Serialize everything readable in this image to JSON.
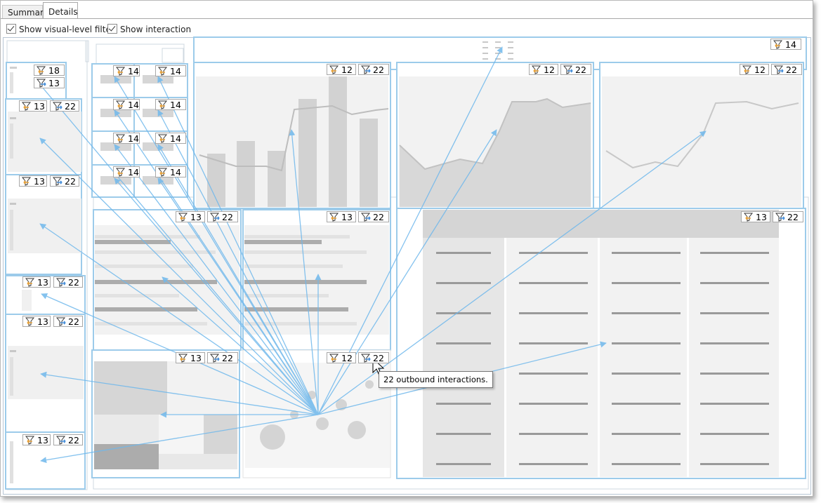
{
  "tabs": [
    {
      "label": "Summary",
      "active": false
    },
    {
      "label": "Details",
      "active": true
    }
  ],
  "options": {
    "show_visual_level_filter": {
      "label": "Show visual-level filter",
      "checked": true
    },
    "show_interaction": {
      "label": "Show interaction",
      "checked": true
    }
  },
  "badges": {
    "slicer1_filters": "18",
    "slicer1_interactions": "13",
    "slicer2_filters": "13",
    "slicer2_interactions": "22",
    "slicer3_filters": "13",
    "slicer3_interactions": "22",
    "slicer4_filters": "13",
    "slicer4_interactions": "22",
    "slicer5_filters": "13",
    "slicer5_interactions": "22",
    "slicer6_filters": "13",
    "slicer6_interactions": "22",
    "card1_filters": "14",
    "card2_filters": "14",
    "card3_filters": "14",
    "card4_filters": "14",
    "card5_filters": "14",
    "card6_filters": "14",
    "card7_filters": "14",
    "card8_filters": "14",
    "title_filters": "14",
    "combo_filters": "12",
    "combo_interactions": "22",
    "area1_filters": "12",
    "area1_interactions": "22",
    "area2_filters": "12",
    "area2_interactions": "22",
    "bar1_filters": "13",
    "bar1_interactions": "22",
    "bar2_filters": "13",
    "bar2_interactions": "22",
    "treemap_filters": "13",
    "treemap_interactions": "22",
    "scatter_filters": "12",
    "scatter_interactions": "22",
    "table_filters": "13",
    "table_interactions": "22"
  },
  "tooltip": "22 outbound interactions.",
  "colors": {
    "visual_border": "#9ccbea",
    "arrow": "#6fb8ec",
    "filter_icon": "#e8a23a",
    "interaction_icon": "#4a90d9",
    "placeholder_gray": "#d2d2d2",
    "placeholder_light": "#f0f0f0"
  }
}
